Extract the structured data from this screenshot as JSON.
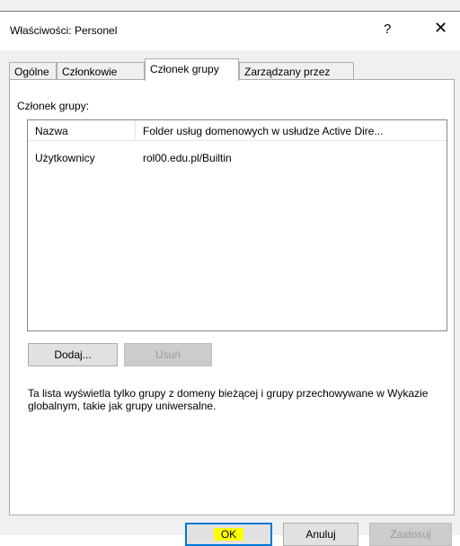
{
  "window": {
    "title": "Właściwości: Personel",
    "help_symbol": "?",
    "close_symbol": "✕"
  },
  "tabs": [
    {
      "label": "Ogólne",
      "active": false
    },
    {
      "label": "Członkowie",
      "active": false
    },
    {
      "label": "Członek grupy",
      "active": true
    },
    {
      "label": "Zarządzany przez",
      "active": false
    }
  ],
  "member_of": {
    "label": "Członek grupy:",
    "columns": [
      "Nazwa",
      "Folder usług domenowych w usłudze Active Dire..."
    ],
    "rows": [
      {
        "name": "Użytkownicy",
        "folder": "rol00.edu.pl/Builtin"
      }
    ]
  },
  "buttons": {
    "add": "Dodaj...",
    "remove": "Usuń",
    "ok": "OK",
    "cancel": "Anuluj",
    "apply": "Zastosuj"
  },
  "info_text": "Ta lista wyświetla tylko grupy z domeny bieżącej i grupy przechowywane w Wykazie globalnym, takie jak grupy uniwersalne.",
  "colors": {
    "accent": "#0078d7",
    "highlight": "#ffff00",
    "window_bg": "#f0f0f0"
  }
}
